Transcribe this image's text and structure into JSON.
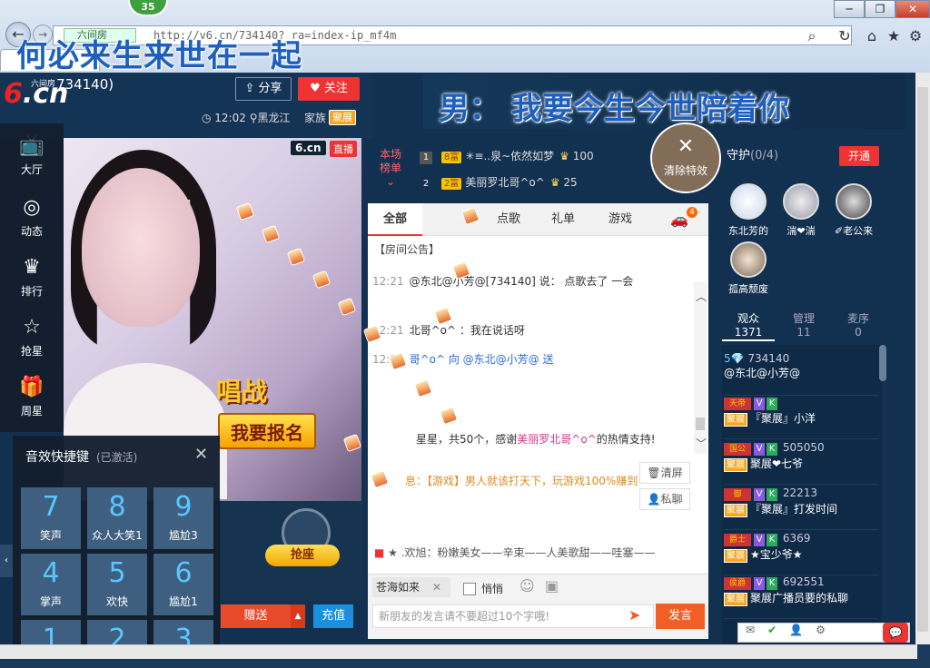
{
  "browser": {
    "badge": "35",
    "address": "http://v6.cn/734140?_ra=index-ip_mf4m",
    "tab_chip": "六间房",
    "danmu_top": "何必来生来世在一起"
  },
  "header": {
    "logo": "6.cn",
    "logo_sub": "六间房",
    "room_id": "734140)",
    "share": "分享",
    "follow": "关注",
    "time": "12:02",
    "location": "黑龙江",
    "family_label": "家族",
    "family_tag": "聚展"
  },
  "sidebar": {
    "items": [
      {
        "icon": "tv-icon",
        "label": "大厅"
      },
      {
        "icon": "compass-icon",
        "label": "动态"
      },
      {
        "icon": "crown-icon",
        "label": "排行"
      },
      {
        "icon": "star-icon",
        "label": "抢星"
      },
      {
        "icon": "gift-icon",
        "label": "周星"
      }
    ]
  },
  "video": {
    "watermark": "6.cn",
    "live": "直播",
    "contest": "唱战",
    "signup": "我要报名"
  },
  "seat": {
    "grab": "抢座"
  },
  "gift": {
    "send": "赠送",
    "recharge": "充值"
  },
  "sound": {
    "title": "音效快捷键",
    "status": "(已激活)",
    "keys": [
      {
        "num": "7",
        "label": "笑声"
      },
      {
        "num": "8",
        "label": "众人大笑1"
      },
      {
        "num": "9",
        "label": "尴尬3"
      },
      {
        "num": "4",
        "label": "掌声"
      },
      {
        "num": "5",
        "label": "欢快"
      },
      {
        "num": "6",
        "label": "尴尬1"
      },
      {
        "num": "1",
        "label": ""
      },
      {
        "num": "2",
        "label": ""
      },
      {
        "num": "3",
        "label": ""
      }
    ]
  },
  "banner": {
    "danmu": "男：  我要今生今世陪着你",
    "clear_fx": "清除特效"
  },
  "rank": {
    "label": "本场榜单",
    "rows": [
      {
        "no": "1",
        "level": "8富",
        "name": "✳≡..泉~依然如梦",
        "coins": "100"
      },
      {
        "no": "2",
        "level": "2富",
        "name": "美丽罗北哥^o^",
        "coins": "25"
      }
    ]
  },
  "chat": {
    "tabs": [
      "全部",
      "点歌",
      "礼单",
      "游戏"
    ],
    "car_badge": "4",
    "notice": "【房间公告】",
    "messages": [
      {
        "ts": "12:21",
        "text": "@东北@小芳@[734140] 说：  点歌去了  一会"
      },
      {
        "ts": "12:21",
        "text": "北哥^o^ ：我在说话呀"
      },
      {
        "ts": "12:21",
        "text": "哥^o^ 向 @东北@小芳@ 送"
      }
    ],
    "thanks_pre": "星星，共50个，感谢",
    "thanks_name": "美丽罗北哥^o^",
    "thanks_post": "的热情支持!",
    "sys": "息：【游戏】男人就该打天下，玩游戏100%赚到",
    "clear_screen": "清屏",
    "private": "私聊",
    "tip": "★ .欢旭：粉嫩美女——辛束——人美歌甜——哇塞——",
    "target": "苍海如来",
    "quiet": "悄悄",
    "placeholder": "新朋友的发言请不要超过10个字哦!",
    "send": "发言"
  },
  "guard": {
    "title": "守护",
    "count": "(0/4)",
    "open": "开通",
    "members": [
      "东北芳的",
      "湍❤湍",
      "✐老公来",
      "孤高颓废"
    ]
  },
  "audience": {
    "tabs": [
      {
        "label": "观众",
        "count": "1371"
      },
      {
        "label": "管理",
        "count": "11"
      },
      {
        "label": "麦序",
        "count": "0"
      }
    ],
    "items": [
      {
        "level": "5💎",
        "id": "734140",
        "name": "@东北@小芳@"
      },
      {
        "level": "天帝",
        "id": "",
        "name": "『聚展』小洋"
      },
      {
        "level": "国公",
        "id": "505050",
        "name": "聚展❤七爷"
      },
      {
        "level": "御",
        "id": "22213",
        "name": "『聚展』打发时间"
      },
      {
        "level": "爵士",
        "id": "6369",
        "name": "★宝少爷★"
      },
      {
        "level": "侯爵",
        "id": "692551",
        "name": "聚展广播员要的私聊"
      }
    ]
  }
}
